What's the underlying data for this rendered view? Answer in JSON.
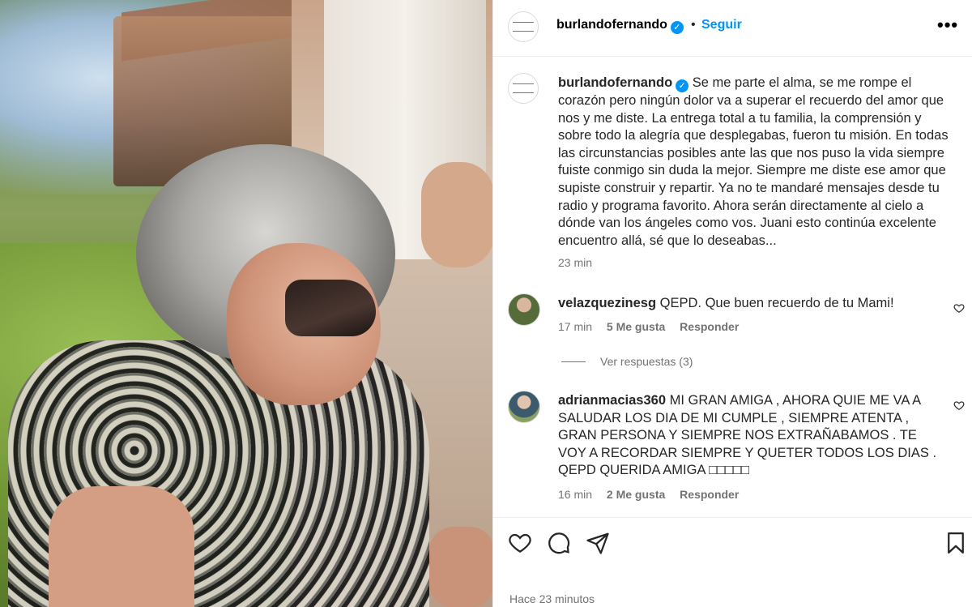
{
  "header": {
    "username": "burlandofernando",
    "separator": "•",
    "follow_label": "Seguir",
    "more_label": "•••"
  },
  "caption": {
    "username": "burlandofernando",
    "text": "Se me parte el alma, se me rompe el corazón pero ningún dolor va a superar el recuerdo del amor que nos y me diste. La entrega total a tu familia, la comprensión y sobre todo la alegría que desplegabas, fueron tu misión. En todas las circunstancias posibles ante las que nos puso la vida siempre fuiste conmigo sin duda la mejor. Siempre me diste ese amor que supiste construir y repartir. Ya no te mandaré mensajes desde tu radio y programa favorito. Ahora serán directamente al cielo a dónde van los ángeles como vos. Juani esto continúa excelente encuentro allá, sé que lo deseabas...",
    "time": "23 min"
  },
  "comments": [
    {
      "username": "velazquezinesg",
      "text": "QEPD. Que buen recuerdo de tu Mami!",
      "time": "17 min",
      "likes": "5 Me gusta",
      "reply": "Responder"
    },
    {
      "username": "adrianmacias360",
      "text": "MI GRAN AMIGA , AHORA QUIE ME VA A SALUDAR LOS DIA DE MI CUMPLE , SIEMPRE ATENTA , GRAN PERSONA Y SIEMPRE NOS EXTRAÑABAMOS . TE VOY A RECORDAR SIEMPRE Y QUETER TODOS LOS DIAS . QEPD QUERIDA AMIGA □□□□□",
      "time": "16 min",
      "likes": "2 Me gusta",
      "reply": "Responder"
    }
  ],
  "replies_label": "Ver respuestas (3)",
  "timestamp": "Hace 23 minutos",
  "colors": {
    "link_blue": "#0095f6",
    "secondary_text": "#737373",
    "divider": "#efefef"
  },
  "icons": [
    "heart-icon",
    "comment-icon",
    "share-icon",
    "bookmark-icon",
    "verified-badge-icon",
    "more-options-icon"
  ]
}
